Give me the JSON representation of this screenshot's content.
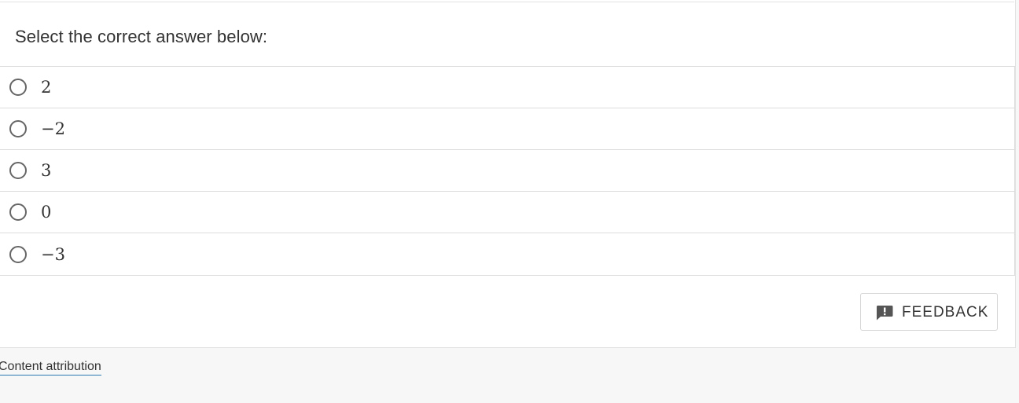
{
  "question": {
    "prompt": "Select the correct answer below:"
  },
  "options": [
    {
      "label": "2"
    },
    {
      "label": "−2"
    },
    {
      "label": "3"
    },
    {
      "label": "0"
    },
    {
      "label": "−3"
    }
  ],
  "feedback": {
    "label": "FEEDBACK",
    "icon": "feedback-icon"
  },
  "footer": {
    "attribution": "Content attribution"
  },
  "colors": {
    "page_bg": "#f7f7f7",
    "card_bg": "#ffffff",
    "border": "#dcdcdc",
    "text": "#333333",
    "link_underline": "#2a7ab0"
  }
}
